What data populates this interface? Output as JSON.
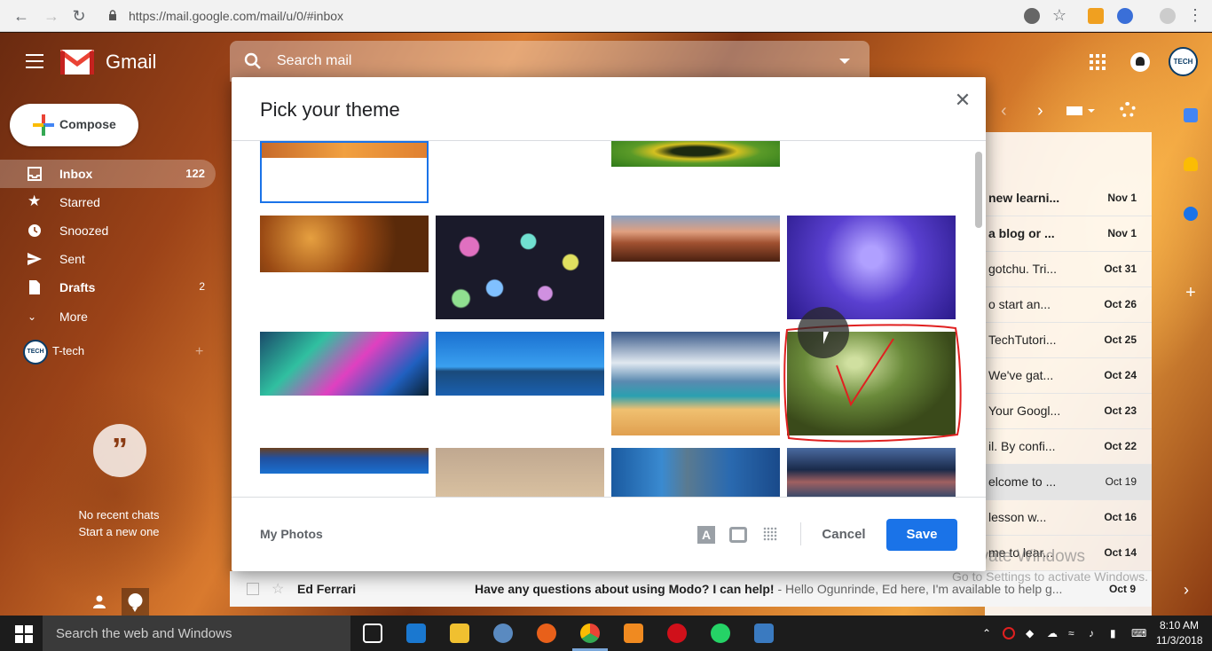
{
  "browser": {
    "url": "https://mail.google.com/mail/u/0/#inbox"
  },
  "gmail": {
    "app_name": "Gmail",
    "search_placeholder": "Search mail",
    "compose_label": "Compose",
    "nav": [
      {
        "label": "Inbox",
        "count": "122"
      },
      {
        "label": "Starred",
        "count": ""
      },
      {
        "label": "Snoozed",
        "count": ""
      },
      {
        "label": "Sent",
        "count": ""
      },
      {
        "label": "Drafts",
        "count": "2"
      },
      {
        "label": "More",
        "count": ""
      }
    ],
    "account_name": "T-tech",
    "avatar_text": "TECH",
    "chat_quote": "”",
    "no_chats": "No recent chats",
    "start_chat": "Start a new one",
    "mail_rows": [
      {
        "subject": "new learni...",
        "date": "Nov 1"
      },
      {
        "subject": "a blog or ...",
        "date": "Nov 1"
      },
      {
        "subject": "gotchu. Tri...",
        "date": "Oct 31"
      },
      {
        "subject": "o start an...",
        "date": "Oct 26"
      },
      {
        "subject": "TechTutori...",
        "date": "Oct 25"
      },
      {
        "subject": "We've gat...",
        "date": "Oct 24"
      },
      {
        "subject": "Your Googl...",
        "date": "Oct 23"
      },
      {
        "subject": "il. By confi...",
        "date": "Oct 22"
      },
      {
        "subject": "elcome to ...",
        "date": "Oct 19"
      },
      {
        "subject": "lesson w...",
        "date": "Oct 16"
      },
      {
        "subject": "me to lear...",
        "date": "Oct 14"
      }
    ],
    "bottom_row": {
      "sender": "Ed Ferrari",
      "subject": "Have any questions about using Modo? I can help!",
      "snippet": " - Hello Ogunrinde, Ed here, I'm available to help g...",
      "date": "Oct 9"
    },
    "watermark_title": "Activate Windows",
    "watermark_sub": "Go to Settings to activate Windows."
  },
  "dialog": {
    "title": "Pick your theme",
    "my_photos": "My Photos",
    "text_bg_icon_letter": "A",
    "cancel": "Cancel",
    "save": "Save",
    "themes": [
      {
        "name": "canyon",
        "selected": true
      },
      {
        "name": "empty",
        "selected": false
      },
      {
        "name": "caterpillar",
        "selected": false
      },
      {
        "name": "empty",
        "selected": false
      },
      {
        "name": "autumn-leaves",
        "selected": false
      },
      {
        "name": "bokeh",
        "selected": false
      },
      {
        "name": "canyon-sunset",
        "selected": false
      },
      {
        "name": "jellyfish",
        "selected": false
      },
      {
        "name": "rainbow-bubble",
        "selected": false
      },
      {
        "name": "lake",
        "selected": false
      },
      {
        "name": "beach",
        "selected": false
      },
      {
        "name": "forest",
        "selected": false,
        "highlighted": true
      },
      {
        "name": "tree-sky",
        "selected": false
      },
      {
        "name": "sand",
        "selected": false
      },
      {
        "name": "skyscraper",
        "selected": false
      },
      {
        "name": "storm-clouds",
        "selected": false
      }
    ]
  },
  "taskbar": {
    "search_text": "Search the web and Windows",
    "time": "8:10 AM",
    "date": "11/3/2018"
  },
  "colors": {
    "accent": "#1a73e8",
    "annotation": "#e02020"
  }
}
